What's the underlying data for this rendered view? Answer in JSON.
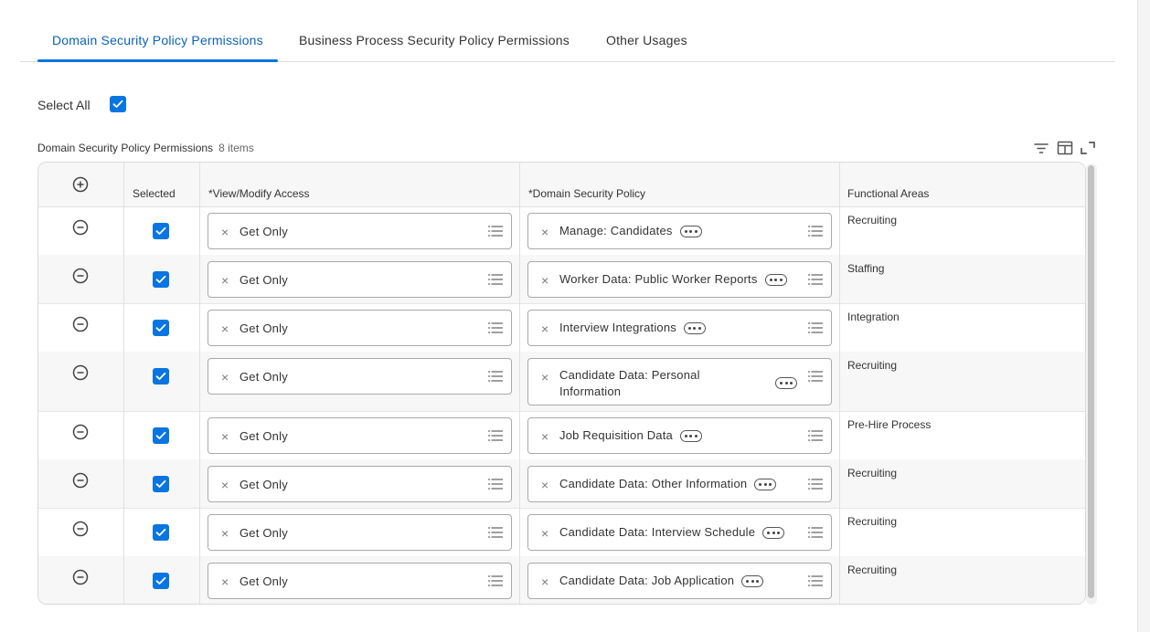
{
  "tabs": [
    {
      "label": "Domain Security Policy Permissions",
      "active": true
    },
    {
      "label": "Business Process Security Policy Permissions",
      "active": false
    },
    {
      "label": "Other Usages",
      "active": false
    }
  ],
  "select_all": {
    "label": "Select All",
    "checked": true
  },
  "grid": {
    "title": "Domain Security Policy Permissions",
    "count": "8 items",
    "columns": {
      "selected": "Selected",
      "access": "*View/Modify Access",
      "policy": "*Domain Security Policy",
      "areas": "Functional Areas"
    },
    "rows": [
      {
        "access": "Get Only",
        "policy": "Manage: Candidates",
        "area": "Recruiting"
      },
      {
        "access": "Get Only",
        "policy": "Worker Data: Public Worker Reports",
        "area": "Staffing"
      },
      {
        "access": "Get Only",
        "policy": "Interview Integrations",
        "area": "Integration"
      },
      {
        "access": "Get Only",
        "policy_line1": "Candidate Data: Personal",
        "policy_line2": "Information",
        "area": "Recruiting"
      },
      {
        "access": "Get Only",
        "policy": "Job Requisition Data",
        "area": "Pre-Hire Process"
      },
      {
        "access": "Get Only",
        "policy": "Candidate Data: Other Information",
        "area": "Recruiting"
      },
      {
        "access": "Get Only",
        "policy": "Candidate Data: Interview Schedule",
        "area": "Recruiting"
      },
      {
        "access": "Get Only",
        "policy": "Candidate Data: Job Application",
        "area": "Recruiting"
      }
    ]
  },
  "colors": {
    "accent": "#0875e1",
    "active_tab_text": "#0b61b8",
    "border": "#a9a9a9"
  },
  "icons": {
    "add_row": "plus-circle-icon",
    "remove_row": "minus-circle-icon",
    "clear": "x-icon",
    "prompt": "list-icon",
    "related": "related-actions-icon",
    "filter": "filter-icon",
    "columns": "columns-icon",
    "fullscreen": "expand-icon"
  }
}
